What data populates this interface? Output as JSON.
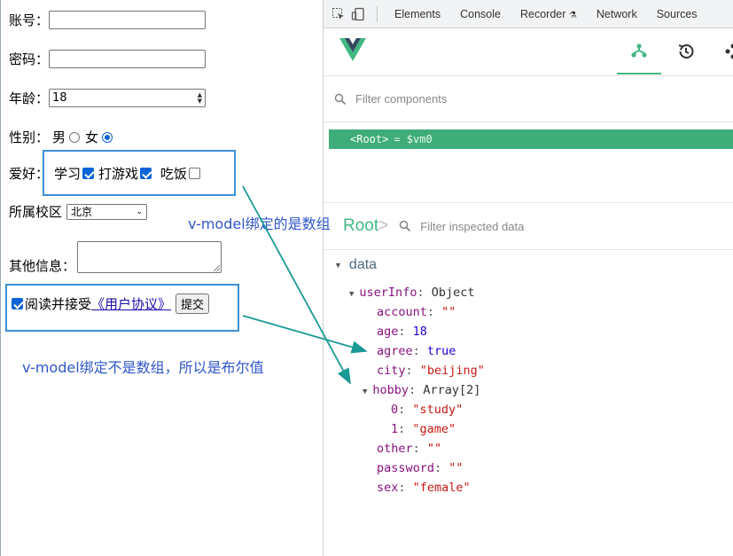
{
  "form": {
    "account": {
      "label": "账号：",
      "value": ""
    },
    "password": {
      "label": "密码：",
      "value": ""
    },
    "age": {
      "label": "年龄：",
      "value": "18"
    },
    "sex": {
      "label": "性别：",
      "options": [
        "男",
        "女"
      ],
      "selected": "女"
    },
    "hobby": {
      "label": "爱好：",
      "options": [
        {
          "label": "学习",
          "checked": true
        },
        {
          "label": "打游戏",
          "checked": true
        },
        {
          "label": "吃饭",
          "checked": false
        }
      ]
    },
    "campus": {
      "label": "所属校区",
      "selected": "北京"
    },
    "other": {
      "label": "其他信息：",
      "value": ""
    },
    "agree": {
      "checked": true,
      "text": "阅读并接受",
      "link": "《用户协议》",
      "submit": "提交"
    }
  },
  "annotations": {
    "hobby_note": "v-model绑定的是数组",
    "agree_note": "v-model绑定不是数组，所以是布尔值"
  },
  "devtools": {
    "tabs": [
      "Elements",
      "Console",
      "Recorder",
      "Network",
      "Sources"
    ],
    "filter_components_placeholder": "Filter components",
    "root_node": "<Root>",
    "root_vm": "= $vm0",
    "inspect_title": "Root",
    "inspect_title_bracket": ">",
    "filter_inspected_placeholder": "Filter inspected data",
    "data_section": "data",
    "state": {
      "userInfo_key": "userInfo",
      "userInfo_type": "Object",
      "fields": [
        {
          "key": "account",
          "value": "\"\"",
          "kind": "str"
        },
        {
          "key": "age",
          "value": "18",
          "kind": "num"
        },
        {
          "key": "agree",
          "value": "true",
          "kind": "bool"
        },
        {
          "key": "city",
          "value": "\"beijing\"",
          "kind": "str"
        },
        {
          "key": "hobby",
          "value": "Array[2]",
          "kind": "type"
        },
        {
          "key": "0",
          "value": "\"study\"",
          "kind": "str"
        },
        {
          "key": "1",
          "value": "\"game\"",
          "kind": "str"
        },
        {
          "key": "other",
          "value": "\"\"",
          "kind": "str"
        },
        {
          "key": "password",
          "value": "\"\"",
          "kind": "str"
        },
        {
          "key": "sex",
          "value": "\"female\"",
          "kind": "str"
        }
      ]
    }
  },
  "colors": {
    "vue_green": "#42b883",
    "annotation_blue": "#2f57c9",
    "arrow_teal": "#1a9a94"
  }
}
